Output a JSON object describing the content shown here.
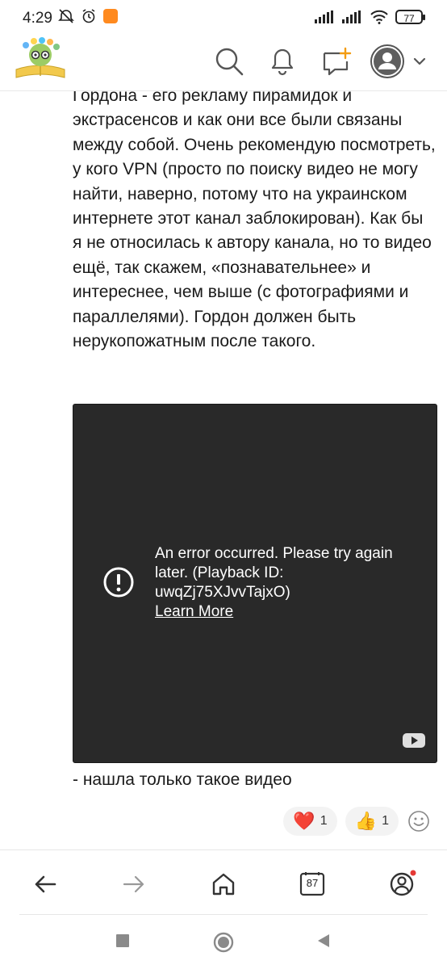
{
  "status_bar": {
    "time": "4:29",
    "battery": "77"
  },
  "header": {
    "icons": [
      "search-icon",
      "bell-icon",
      "new-message-icon",
      "avatar-icon",
      "chevron-down-icon"
    ]
  },
  "post": {
    "comment_text": "Гордона - его рекламу пирамидок и экстрасенсов и как они все были связаны между собой. Очень рекомендую посмотреть, у кого VPN (просто по поиску видео не могу найти, наверно, потому что на украинском интернете этот канал заблокирован). Как бы я не относилась к автору канала, но то видео ещё, так скажем, «познавательнее» и интереснее, чем выше (с фотографиями и параллелями). Гордон должен быть нерукопожатным после такого.",
    "video": {
      "error_message": "An error occurred. Please try again later. (Playback ID: uwqZj75XJvvTajxO)",
      "learn_more": "Learn More"
    },
    "caption": "- нашла только такое видео",
    "reactions": [
      {
        "emoji": "❤️",
        "count": "1"
      },
      {
        "emoji": "👍",
        "count": "1"
      }
    ]
  },
  "browser_nav": {
    "tab_count": "87",
    "icons": [
      "back-arrow-icon",
      "forward-arrow-icon",
      "home-icon",
      "tabs-icon",
      "profile-icon"
    ]
  },
  "colors": {
    "video_bg": "#292929",
    "notification_dot": "#e53935",
    "accent_orange": "#ff8a1f"
  }
}
